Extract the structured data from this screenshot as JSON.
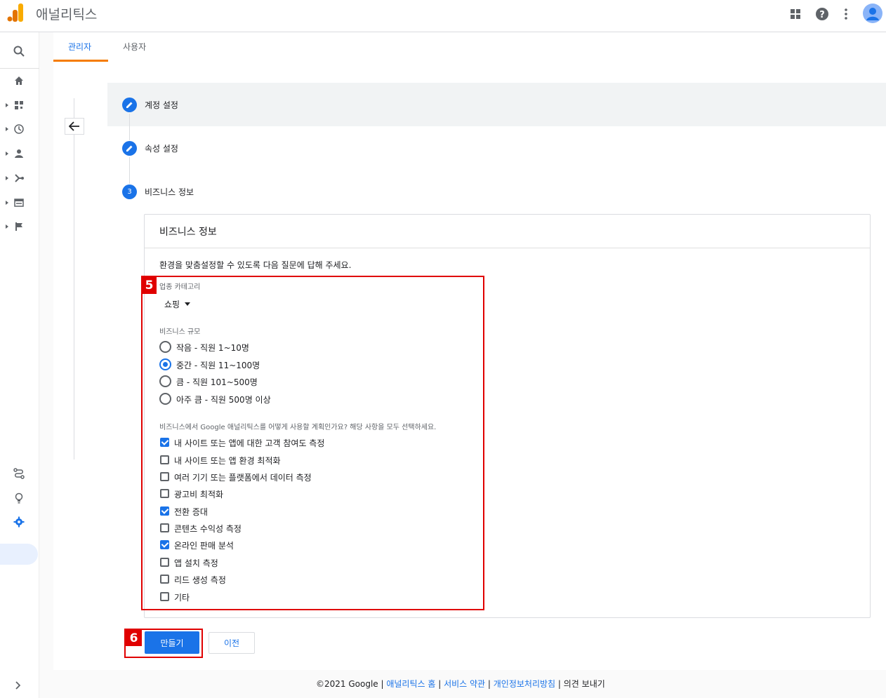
{
  "app": {
    "title": "애널리틱스"
  },
  "tabs": [
    {
      "label": "관리자",
      "active": true
    },
    {
      "label": "사용자",
      "active": false
    }
  ],
  "steps": [
    {
      "label": "계정 설정",
      "state": "done"
    },
    {
      "label": "속성 설정",
      "state": "done"
    },
    {
      "number": "3",
      "label": "비즈니스 정보",
      "state": "active"
    }
  ],
  "card": {
    "title": "비즈니스 정보",
    "intro": "환경을 맞춤설정할 수 있도록 다음 질문에 답해 주세요.",
    "industry_label": "업종 카테고리",
    "industry_value": "쇼핑",
    "size_label": "비즈니스 규모",
    "size_options": [
      {
        "label": "작음 - 직원 1~10명",
        "selected": false
      },
      {
        "label": "중간 - 직원 11~100명",
        "selected": true
      },
      {
        "label": "큼 - 직원 101~500명",
        "selected": false
      },
      {
        "label": "아주 큼 - 직원 500명 이상",
        "selected": false
      }
    ],
    "usage_label": "비즈니스에서 Google 애널리틱스를 어떻게 사용할 계획인가요? 해당 사항을 모두 선택하세요.",
    "usage_options": [
      {
        "label": "내 사이트 또는 앱에 대한 고객 참여도 측정",
        "checked": true
      },
      {
        "label": "내 사이트 또는 앱 환경 최적화",
        "checked": false
      },
      {
        "label": "여러 기기 또는 플랫폼에서 데이터 측정",
        "checked": false
      },
      {
        "label": "광고비 최적화",
        "checked": false
      },
      {
        "label": "전환 증대",
        "checked": true
      },
      {
        "label": "콘텐츠 수익성 측정",
        "checked": false
      },
      {
        "label": "온라인 판매 분석",
        "checked": true
      },
      {
        "label": "앱 설치 측정",
        "checked": false
      },
      {
        "label": "리드 생성 측정",
        "checked": false
      },
      {
        "label": "기타",
        "checked": false
      }
    ]
  },
  "annotations": {
    "badge_5": "5",
    "badge_6": "6"
  },
  "buttons": {
    "create": "만들기",
    "prev": "이전"
  },
  "footer": {
    "copyright": "©2021 Google",
    "sep": " | ",
    "home": "애널리틱스 홈",
    "terms": "서비스 약관",
    "privacy": "개인정보처리방침",
    "feedback": "의견 보내기"
  },
  "colors": {
    "accent": "#1a73e8",
    "tab_underline": "#f57c00",
    "annotation": "#e00000"
  },
  "icons": [
    "analytics-logo-icon",
    "apps-icon",
    "help-icon",
    "more-vert-icon",
    "account-icon",
    "search-icon",
    "home-icon",
    "dashboard-icon",
    "realtime-icon",
    "audience-icon",
    "acquisition-icon",
    "behavior-icon",
    "conversions-icon",
    "attribution-icon",
    "discover-icon",
    "admin-gear-icon",
    "arrow-back-icon",
    "pencil-icon",
    "dropdown-caret-icon",
    "expand-icon"
  ]
}
